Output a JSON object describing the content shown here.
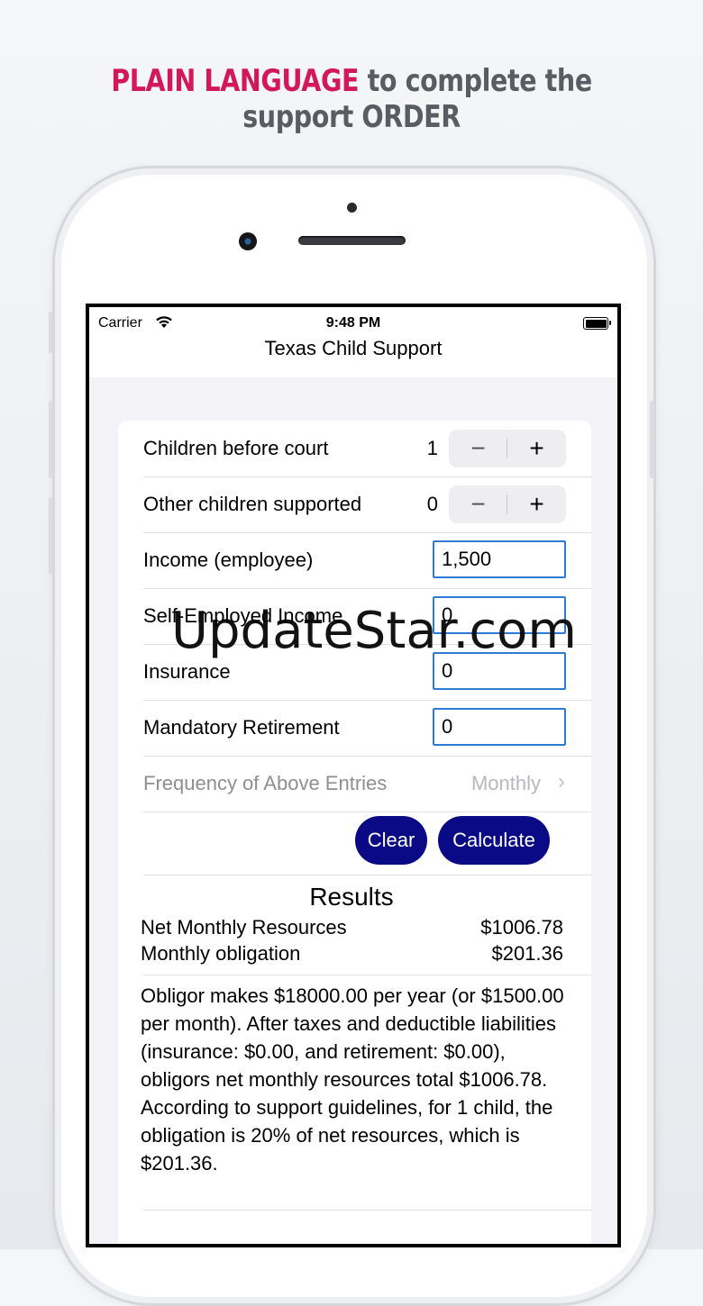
{
  "headline": {
    "highlight": "PLAIN LANGUAGE",
    "rest": "to complete the support ORDER"
  },
  "status": {
    "carrier": "Carrier",
    "time": "9:48 PM"
  },
  "nav": {
    "title": "Texas Child Support"
  },
  "children_before_court": {
    "label": "Children before court",
    "value": "1",
    "minus": "−",
    "plus": "+"
  },
  "other_children": {
    "label": "Other children supported",
    "value": "0",
    "minus": "−",
    "plus": "+"
  },
  "income_employee": {
    "label": "Income (employee)",
    "value": "1,500"
  },
  "self_employed": {
    "label": "Self-Employed Income",
    "value": "0"
  },
  "insurance": {
    "label": "Insurance",
    "value": "0"
  },
  "retirement": {
    "label": "Mandatory Retirement",
    "value": "0"
  },
  "frequency": {
    "label": "Frequency of Above Entries",
    "value": "Monthly",
    "chevron": "›"
  },
  "buttons": {
    "clear": "Clear",
    "calculate": "Calculate"
  },
  "results": {
    "title": "Results",
    "net_label": "Net Monthly Resources",
    "net_value": "$1006.78",
    "obligation_label": "Monthly obligation",
    "obligation_value": "$201.36",
    "summary": "Obligor makes $18000.00 per year (or $1500.00 per month). After taxes and deductible liabilities (insurance: $0.00, and retirement: $0.00), obligors net monthly resources total $1006.78. According to support guidelines, for 1 child, the obligation is 20% of net resources, which is $201.36."
  },
  "watermark": "UpdateStar.com",
  "colors": {
    "accent_pink": "#d3185a",
    "button_blue": "#0b0a86",
    "field_border": "#2f7ad4"
  }
}
